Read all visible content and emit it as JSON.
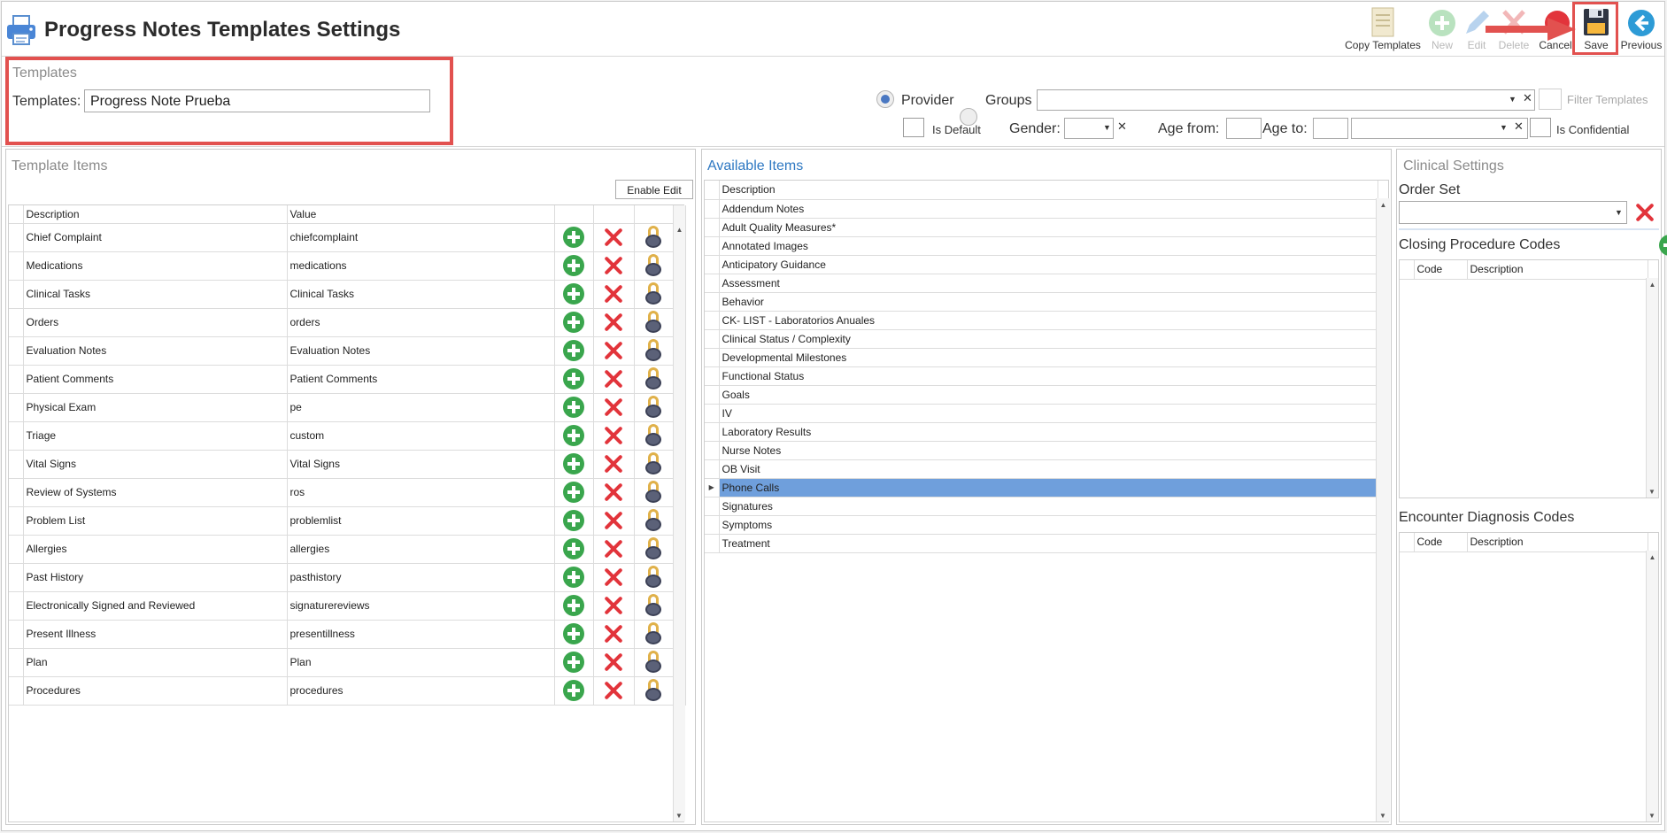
{
  "header": {
    "title": "Progress Notes Templates Settings",
    "toolbar": {
      "copy_templates": "Copy Templates",
      "new": "New",
      "edit": "Edit",
      "delete": "Delete",
      "cancel": "Cancel",
      "save": "Save",
      "previous": "Previous"
    }
  },
  "templates_box": {
    "group_title": "Templates",
    "label": "Templates:",
    "value": "Progress Note Prueba"
  },
  "filters": {
    "provider": "Provider",
    "groups": "Groups",
    "filter_templates": "Filter Templates",
    "is_default": "Is Default",
    "gender": "Gender:",
    "age_from": "Age from:",
    "age_to": "Age to:",
    "is_confidential": "Is Confidential",
    "selected_radio": "Provider"
  },
  "template_items": {
    "title": "Template Items",
    "enable_edit": "Enable Edit",
    "columns": [
      "Description",
      "Value"
    ],
    "rows": [
      {
        "description": "Chief Complaint",
        "value": "chiefcomplaint"
      },
      {
        "description": "Medications",
        "value": "medications"
      },
      {
        "description": "Clinical Tasks",
        "value": "Clinical Tasks"
      },
      {
        "description": "Orders",
        "value": "orders"
      },
      {
        "description": "Evaluation Notes",
        "value": "Evaluation Notes"
      },
      {
        "description": "Patient Comments",
        "value": "Patient Comments"
      },
      {
        "description": "Physical Exam",
        "value": "pe"
      },
      {
        "description": "Triage",
        "value": "custom"
      },
      {
        "description": "Vital Signs",
        "value": "Vital Signs"
      },
      {
        "description": "Review of Systems",
        "value": "ros"
      },
      {
        "description": "Problem List",
        "value": "problemlist"
      },
      {
        "description": "Allergies",
        "value": "allergies"
      },
      {
        "description": "Past History",
        "value": "pasthistory"
      },
      {
        "description": "Electronically Signed and Reviewed",
        "value": "signaturereviews"
      },
      {
        "description": "Present Illness",
        "value": "presentillness"
      },
      {
        "description": "Plan",
        "value": "Plan"
      },
      {
        "description": "Procedures",
        "value": "procedures"
      }
    ]
  },
  "available_items": {
    "title": "Available Items",
    "column": "Description",
    "selected": "Phone Calls",
    "rows": [
      "Addendum Notes",
      "Adult Quality Measures*",
      "Annotated Images",
      "Anticipatory Guidance",
      "Assessment",
      "Behavior",
      "CK- LIST - Laboratorios Anuales",
      "Clinical Status / Complexity",
      "Developmental Milestones",
      "Functional Status",
      "Goals",
      "IV",
      "Laboratory Results",
      "Nurse Notes",
      "OB Visit",
      "Phone Calls",
      "Signatures",
      "Symptoms",
      "Treatment"
    ]
  },
  "clinical_settings": {
    "title": "Clinical Settings",
    "order_set": "Order Set",
    "closing_procedure_codes": "Closing Procedure Codes",
    "encounter_diagnosis_codes": "Encounter Diagnosis Codes",
    "code_col": "Code",
    "description_col": "Description"
  },
  "colors": {
    "highlight": "#e2514f",
    "selection": "#6f9fdc",
    "accent_blue": "#2e78c2",
    "add_green": "#3aa64d",
    "delete_red": "#e2343b"
  },
  "icons": [
    "printer-icon",
    "copy-templates-icon",
    "new-icon",
    "edit-icon",
    "delete-icon",
    "cancel-icon",
    "save-icon",
    "previous-icon",
    "add-icon",
    "remove-icon",
    "lock-icon",
    "annotation-arrow-icon"
  ]
}
